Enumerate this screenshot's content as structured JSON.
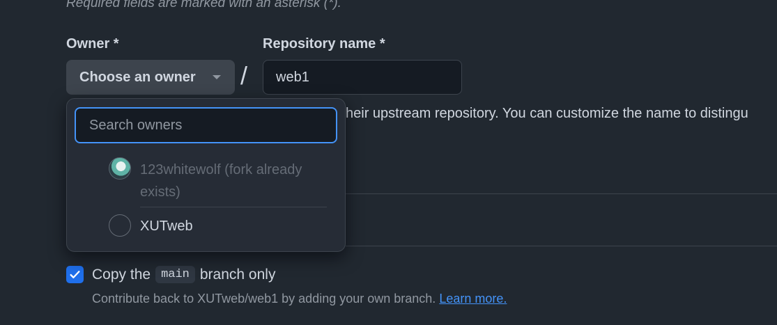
{
  "form": {
    "required_note": "Required fields are marked with an asterisk (*).",
    "owner_label": "Owner *",
    "owner_button_label": "Choose an owner",
    "separator": "/",
    "repo_name_label": "Repository name *",
    "repo_name_value": "web1",
    "description_partial": "heir upstream repository. You can customize the name to distingu"
  },
  "owner_dropdown": {
    "search_placeholder": "Search owners",
    "options": [
      {
        "label": "123whitewolf (fork already exists)",
        "disabled": true,
        "avatar": "wolf-avatar"
      },
      {
        "label": "XUTweb",
        "disabled": false,
        "avatar": "empty-avatar"
      }
    ]
  },
  "copy_branch": {
    "checked": true,
    "prefix": "Copy the",
    "branch": "main",
    "suffix": "branch only",
    "help_text": "Contribute back to XUTweb/web1 by adding your own branch.",
    "learn_more": "Learn more."
  },
  "colors": {
    "background": "#212830",
    "accent": "#4493f8",
    "checkbox": "#1f6feb"
  }
}
